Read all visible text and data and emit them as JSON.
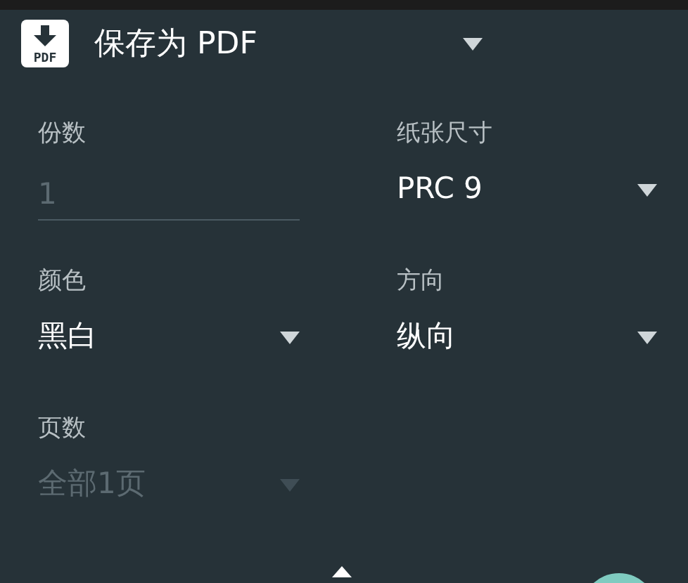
{
  "header": {
    "icon_text": "PDF",
    "title": "保存为 PDF"
  },
  "fields": [
    {
      "kind": "input",
      "label": "份数",
      "value": "1",
      "disabled": true
    },
    {
      "kind": "select",
      "label": "纸张尺寸",
      "value": "PRC 9",
      "disabled": false
    },
    {
      "kind": "select",
      "label": "颜色",
      "value": "黑白",
      "disabled": false
    },
    {
      "kind": "select",
      "label": "方向",
      "value": "纵向",
      "disabled": false
    },
    {
      "kind": "select",
      "label": "页数",
      "value": "全部1页",
      "disabled": true
    }
  ]
}
